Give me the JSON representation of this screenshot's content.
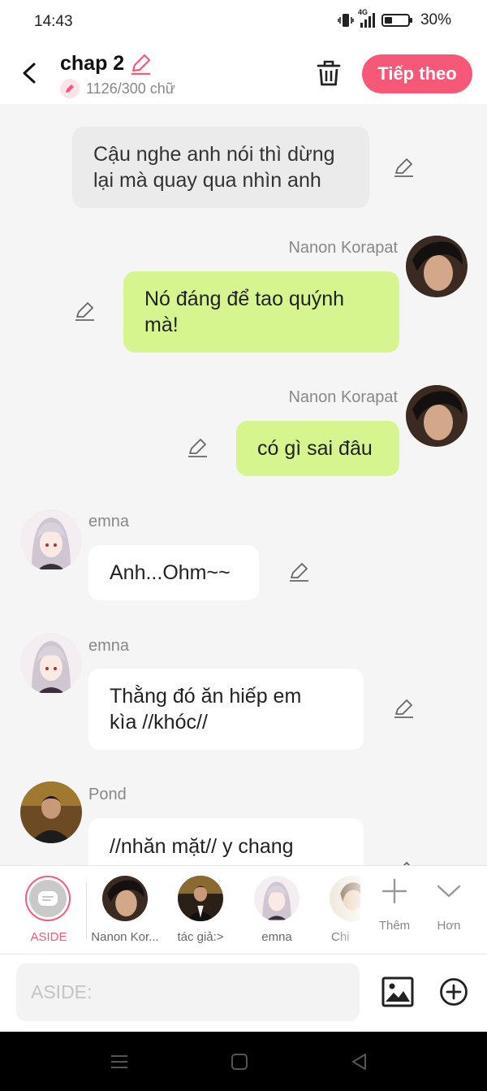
{
  "status_bar": {
    "time": "14:43",
    "network": "4G",
    "battery": "30%"
  },
  "header": {
    "title": "chap 2",
    "word_count": "1126/300 chữ",
    "next_button": "Tiếp theo"
  },
  "messages": [
    {
      "type": "narration",
      "text_lines": [
        "Cậu nghe anh nói thì dừng",
        "lại mà quay qua nhìn anh"
      ]
    },
    {
      "type": "right",
      "speaker": "Nanon Korapat",
      "text_lines": [
        "Nó đáng để tao quýnh",
        "mà!"
      ]
    },
    {
      "type": "right",
      "speaker": "Nanon Korapat",
      "text_lines": [
        "có gì sai đâu"
      ]
    },
    {
      "type": "left",
      "speaker": "emna",
      "text_lines": [
        "Anh...Ohm~~"
      ]
    },
    {
      "type": "left",
      "speaker": "emna",
      "text_lines": [
        "Thằng đó ăn hiếp em",
        "kìa //khóc//"
      ]
    },
    {
      "type": "left",
      "speaker": "Pond",
      "text_lines": [
        "//nhăn mặt// y chang"
      ]
    }
  ],
  "characters": {
    "aside_label": "ASIDE",
    "items": [
      {
        "label": "Nanon Kor..."
      },
      {
        "label": "tác giả:>"
      },
      {
        "label": "emna"
      },
      {
        "label": "Chi"
      }
    ],
    "more_label": "Thêm",
    "expand_label": "Hơn"
  },
  "input": {
    "placeholder": "ASIDE:",
    "value": ""
  },
  "colors": {
    "accent": "#f75878",
    "green_bubble": "#d6f58f",
    "narration_bubble": "#ebebeb",
    "background": "#f5f5f5"
  },
  "icons": [
    "vibrate-icon",
    "signal-icon",
    "battery-icon",
    "back-icon",
    "pencil-icon",
    "trash-icon",
    "image-icon",
    "plus-circle-icon",
    "menu-nav-icon",
    "home-nav-icon",
    "back-nav-icon"
  ]
}
